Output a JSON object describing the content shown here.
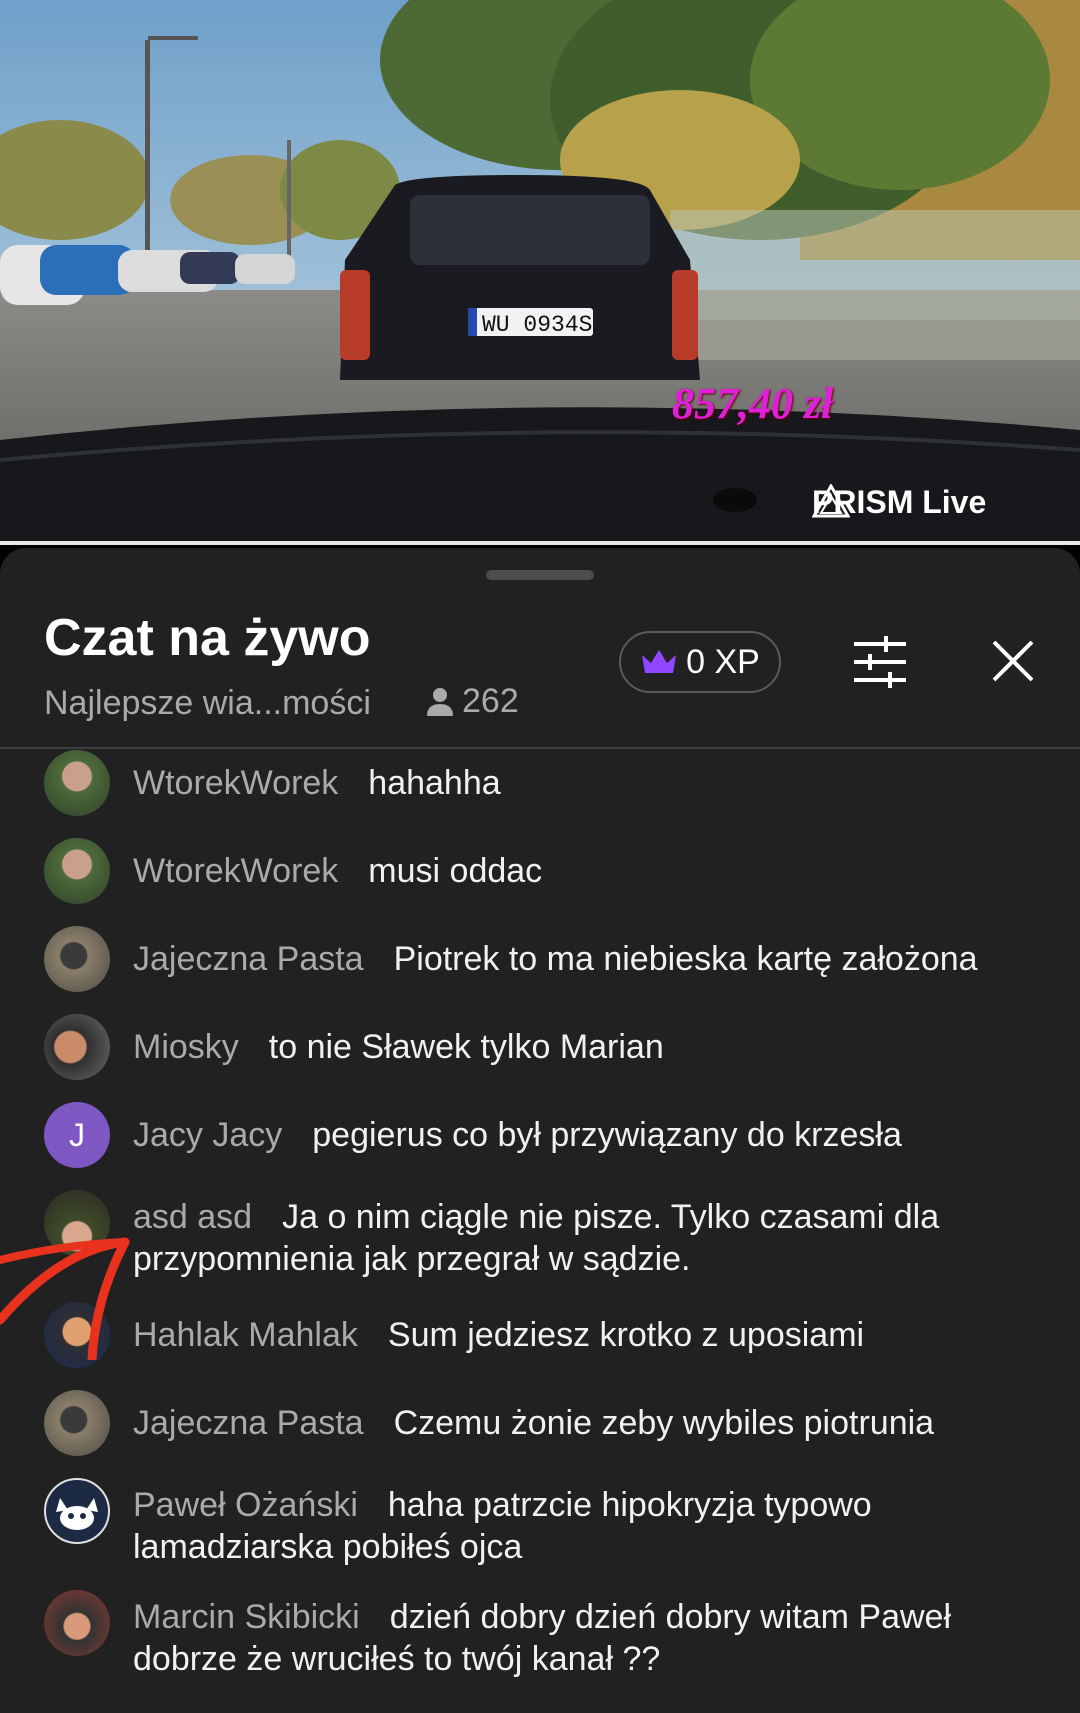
{
  "video": {
    "overlay_amount": "857,40 zł",
    "license_plate": "WU 0934S",
    "watermark": "PRISM Live",
    "colors": {
      "overlay_amount": "#e01fd8"
    }
  },
  "chat": {
    "title": "Czat na żywo",
    "subtitle": "Najlepsze wia...mości",
    "viewer_count": "262",
    "xp_label": "0 XP",
    "colors": {
      "background": "#212121",
      "crown": "#9146ff",
      "author": "#aaaaaa"
    },
    "messages": [
      {
        "author": "WtorekWorek",
        "text": "hahahha",
        "avatar": "photo-avatar"
      },
      {
        "author": "WtorekWorek",
        "text": "musi oddac",
        "avatar": "photo-avatar"
      },
      {
        "author": "Jajeczna Pasta",
        "text": "Piotrek to ma niebieska kartę założona",
        "avatar": "photo-avatar"
      },
      {
        "author": "Miosky",
        "text": "to nie Sławek tylko Marian",
        "avatar": "photo-avatar"
      },
      {
        "author": "Jacy Jacy",
        "text": "pegierus co był przywiązany do krzesła",
        "avatar": "letter-avatar",
        "avatar_letter": "J"
      },
      {
        "author": "asd asd",
        "text": "Ja o nim ciągle nie pisze. Tylko czasami dla przypomnienia jak przegrał w sądzie.",
        "avatar": "photo-avatar"
      },
      {
        "author": "Hahlak Mahlak",
        "text": "Sum jedziesz krotko z uposiami",
        "avatar": "photo-avatar"
      },
      {
        "author": "Jajeczna Pasta",
        "text": "Czemu żonie zeby wybiles piotrunia",
        "avatar": "photo-avatar"
      },
      {
        "author": "Paweł Ożański",
        "text": "haha patrzcie hipokryzja typowo lamadziarska pobiłeś ojca",
        "avatar": "cat-avatar"
      },
      {
        "author": "Marcin Skibicki",
        "text": "dzień dobry dzień dobry witam Paweł dobrze że wruciłeś to twój kanał ??",
        "avatar": "photo-avatar"
      }
    ]
  }
}
